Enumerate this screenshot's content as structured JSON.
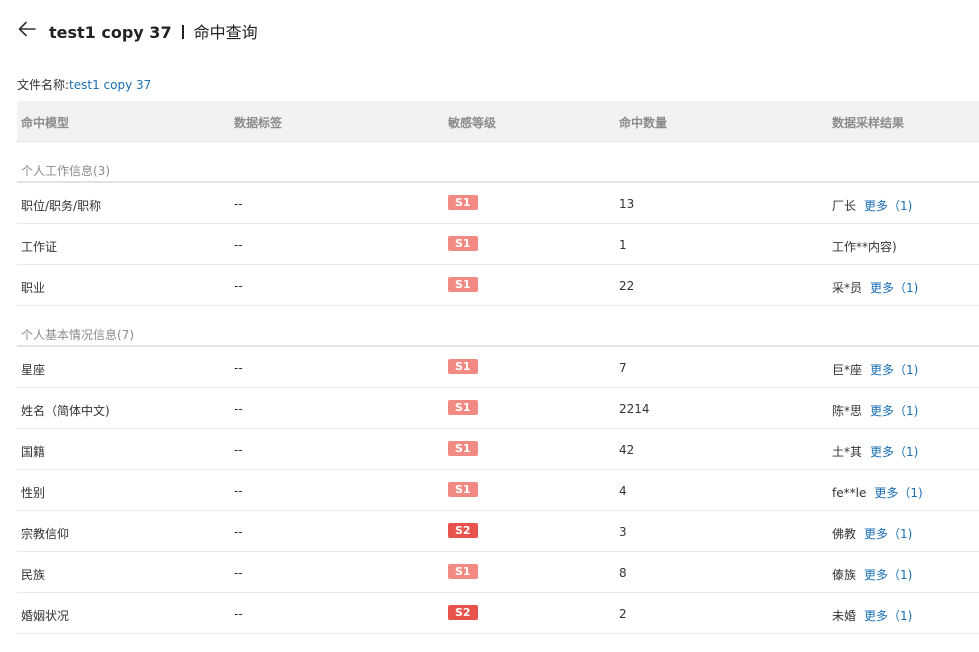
{
  "header": {
    "file_name": "test1 copy 37",
    "page_title": "命中查询"
  },
  "file_info": {
    "label": "文件名称:",
    "value": "test1 copy 37"
  },
  "table": {
    "columns": [
      "命中模型",
      "数据标签",
      "敏感等级",
      "命中数量",
      "数据采样结果"
    ],
    "groups": [
      {
        "name": "个人工作信息",
        "count": "(3)",
        "rows": [
          {
            "model": "职位/职务/职称",
            "label": "--",
            "level": "S1",
            "count": "13",
            "sample": "厂长",
            "more": "更多（1)"
          },
          {
            "model": "工作证",
            "label": "--",
            "level": "S1",
            "count": "1",
            "sample": "工作**内容)",
            "more": ""
          },
          {
            "model": "职业",
            "label": "--",
            "level": "S1",
            "count": "22",
            "sample": "采*员",
            "more": "更多（1)"
          }
        ]
      },
      {
        "name": "个人基本情况信息",
        "count": "(7)",
        "rows": [
          {
            "model": "星座",
            "label": "--",
            "level": "S1",
            "count": "7",
            "sample": "巨*座",
            "more": "更多（1)"
          },
          {
            "model": "姓名（简体中文)",
            "label": "--",
            "level": "S1",
            "count": "2214",
            "sample": "陈*思",
            "more": "更多（1)"
          },
          {
            "model": "国籍",
            "label": "--",
            "level": "S1",
            "count": "42",
            "sample": "土*其",
            "more": "更多（1)"
          },
          {
            "model": "性别",
            "label": "--",
            "level": "S1",
            "count": "4",
            "sample": "fe**le",
            "more": "更多（1)"
          },
          {
            "model": "宗教信仰",
            "label": "--",
            "level": "S2",
            "count": "3",
            "sample": "佛教",
            "more": "更多（1)"
          },
          {
            "model": "民族",
            "label": "--",
            "level": "S1",
            "count": "8",
            "sample": "傣族",
            "more": "更多（1)"
          },
          {
            "model": "婚姻状况",
            "label": "--",
            "level": "S2",
            "count": "2",
            "sample": "未婚",
            "more": "更多（1)"
          }
        ]
      }
    ]
  },
  "colors": {
    "S1": "#f08a82",
    "S2": "#e8524d",
    "link": "#1a6fb3",
    "header_bg": "#f2f2f2"
  },
  "icons": {
    "back": "arrow-left-icon"
  }
}
